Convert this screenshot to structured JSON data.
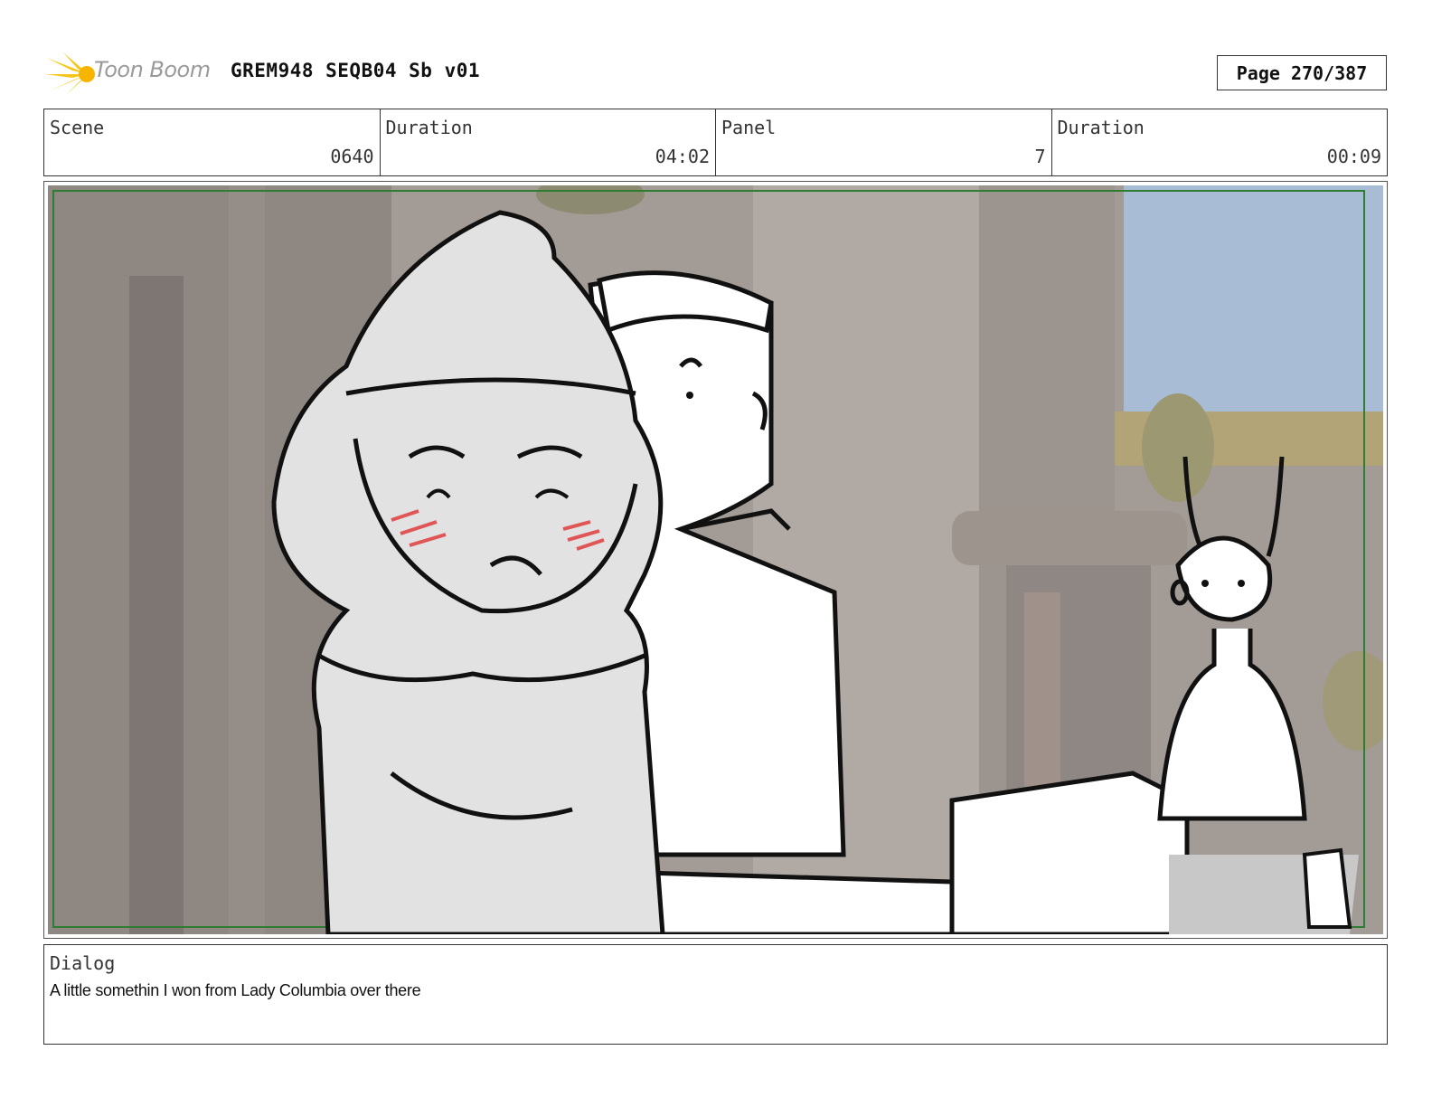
{
  "header": {
    "logo_text": "Toon Boom",
    "title": "GREM948 SEQB04 Sb v01",
    "page": "Page 270/387"
  },
  "info": {
    "scene_label": "Scene",
    "scene_value": "0640",
    "duration_label": "Duration",
    "duration_value": "04:02",
    "panel_label": "Panel",
    "panel_value": "7",
    "panel_duration_label": "Duration",
    "panel_duration_value": "00:09"
  },
  "dialog": {
    "label": "Dialog",
    "text": "A little somethin I won from Lady Columbia over there"
  },
  "colors": {
    "logo_yellow": "#f5c518",
    "safe_frame": "#2e7d32",
    "blush": "#e05555"
  }
}
